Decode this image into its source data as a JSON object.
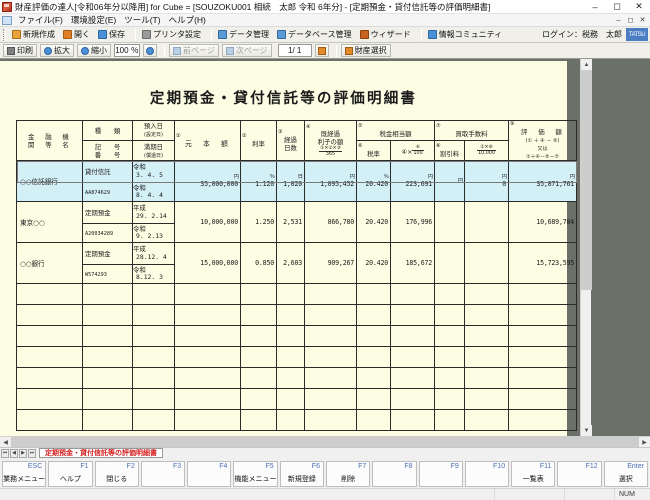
{
  "window": {
    "title": "財産評価の達人[令和06年分以降用] for Cube = [SOUZOKU001 相続　太郎 令和 6年分] - [定期預金・貸付信託等の評価明細書]",
    "minimize": "–",
    "maximize": "◻",
    "close": "✕"
  },
  "menu": {
    "items": [
      "ファイル(F)",
      "環境設定(E)",
      "ツール(T)",
      "ヘルプ(H)"
    ],
    "right_buttons": [
      "–",
      "◻",
      "✕"
    ]
  },
  "toolbar1": {
    "buttons": [
      {
        "label": "新規作成",
        "icon": "new-document-icon",
        "color": "#e8a33d"
      },
      {
        "label": "開く",
        "icon": "open-folder-icon",
        "color": "#e0812a"
      },
      {
        "label": "保存",
        "icon": "save-disk-icon",
        "color": "#4a90d9"
      },
      {
        "label": "プリンタ設定",
        "icon": "printer-icon",
        "color": "#8a8a8a"
      },
      {
        "label": "データ管理",
        "icon": "data-manage-icon",
        "color": "#5b9bd5"
      },
      {
        "label": "データベース管理",
        "icon": "database-icon",
        "color": "#5b9bd5"
      },
      {
        "label": "ウィザード",
        "icon": "wizard-icon",
        "color": "#c8641e"
      },
      {
        "label": "情報コミュニティ",
        "icon": "community-icon",
        "color": "#4a90d9"
      }
    ],
    "login_label": "ログイン：税務　太郎",
    "brand": "TATSU"
  },
  "toolbar2": {
    "print_label": "印刷",
    "zoom_in_label": "拡大",
    "zoom_out_label": "縮小",
    "zoom_value": "100 ％",
    "zoom_picker_icon": "magnifier-icon",
    "prev_page_label": "前ページ",
    "next_page_label": "次ページ",
    "page_value": "1/  1",
    "page_jump_icon": "page-jump-icon",
    "asset_select_label": "財産選択"
  },
  "document": {
    "title": "定期預金・貸付信託等の評価明細書",
    "headers": {
      "institution_line1": "金　融　機",
      "institution_line2": "関　等　名",
      "kind": "種　　類",
      "symbol_line1": "記　　号",
      "symbol_line2": "番　　号",
      "deposit_date_line1": "預入日",
      "deposit_date_line2": "(設定日)",
      "maturity_date_line1": "満期日",
      "maturity_date_line2": "(償還日)",
      "c1_num": "①",
      "c1_label": "元　本　額",
      "c2_num": "②",
      "c2_label": "利率",
      "c3_num": "③",
      "c3_label_line1": "経過",
      "c3_label_line2": "日数",
      "c4_num": "④",
      "c4_label_line1": "既経過",
      "c4_label_line2": "利子の額",
      "c4_formula_top": "①×②×③",
      "c4_formula_bot": "365",
      "c5_num": "⑤",
      "c5_label": "税金相当額",
      "c6_num": "⑥",
      "c6_label": "税率",
      "c5_formula_prefix": "④×",
      "c5_formula_top": "⑥",
      "c5_formula_bot": "100",
      "c7_num": "⑦",
      "c7_label": "買取手数料",
      "c8_num": "⑧",
      "c8_label": "割引料",
      "c7_formula_top": "①×⑧",
      "c7_formula_bot": "10,000",
      "c9_num": "⑨",
      "c9_label": "評　価　額",
      "c9_formula_1": "(① ＋ ④ － ⑤)",
      "c9_formula_2": "又は",
      "c9_formula_3": "①＋④－⑤－⑦"
    },
    "unit_row": {
      "principal": "円",
      "rate": "％",
      "days": "日",
      "interest": "円",
      "tax_rate": "％",
      "tax_amount": "円",
      "fee_discount": "円",
      "fee": "円",
      "valuation": "円"
    },
    "rows": [
      {
        "institution": "○○信託銀行",
        "kind": "貸付信託",
        "account": "AA874629",
        "deposit_era": "令和",
        "deposit_date": "3. 4. 5",
        "maturity_era": "令和",
        "maturity_date": "8. 4. 4",
        "principal": "35,000,000",
        "rate": "1.120",
        "days": "1,020",
        "interest": "1,095,452",
        "tax_rate": "20.420",
        "tax_amount": "223,691",
        "discount_rate": "",
        "fee": "0",
        "valuation": "35,871,761",
        "selected": true
      },
      {
        "institution": "東京○○",
        "kind": "定期預金",
        "account": "A20034289",
        "deposit_era": "平成",
        "deposit_date": "29. 2.14",
        "maturity_era": "令和",
        "maturity_date": "9. 2.13",
        "principal": "10,000,000",
        "rate": "1.250",
        "days": "2,531",
        "interest": "866,780",
        "tax_rate": "20.420",
        "tax_amount": "176,996",
        "discount_rate": "",
        "fee": "",
        "valuation": "10,689,784",
        "selected": false
      },
      {
        "institution": "○○銀行",
        "kind": "定期預金",
        "account": "W574293",
        "deposit_era": "平成",
        "deposit_date": "28.12. 4",
        "maturity_era": "令和",
        "maturity_date": "8.12. 3",
        "principal": "15,000,000",
        "rate": "0.850",
        "days": "2,603",
        "interest": "909,267",
        "tax_rate": "20.420",
        "tax_amount": "185,672",
        "discount_rate": "",
        "fee": "",
        "valuation": "15,723,595",
        "selected": false
      }
    ],
    "empty_row_count": 7
  },
  "tabstrip": {
    "nav": [
      "⏮",
      "◀",
      "▶",
      "⏭"
    ],
    "active_tab": "定期預金・貸付信託等の評価明細書",
    "active_tab_color": "#d42020"
  },
  "function_keys": [
    {
      "num": "ESC",
      "label": "業務メニュー"
    },
    {
      "num": "F1",
      "label": "ヘルプ"
    },
    {
      "num": "F2",
      "label": "閉じる"
    },
    {
      "num": "F3",
      "label": ""
    },
    {
      "num": "F4",
      "label": ""
    },
    {
      "num": "F5",
      "label": "機能メニュー"
    },
    {
      "num": "F6",
      "label": "新規登録"
    },
    {
      "num": "F7",
      "label": "削除"
    },
    {
      "num": "F8",
      "label": ""
    },
    {
      "num": "F9",
      "label": ""
    },
    {
      "num": "F10",
      "label": ""
    },
    {
      "num": "F11",
      "label": "一覧表"
    },
    {
      "num": "F12",
      "label": ""
    },
    {
      "num": "Enter",
      "label": "選択"
    }
  ],
  "statusbar": {
    "message": "",
    "num_lock": "NUM"
  }
}
